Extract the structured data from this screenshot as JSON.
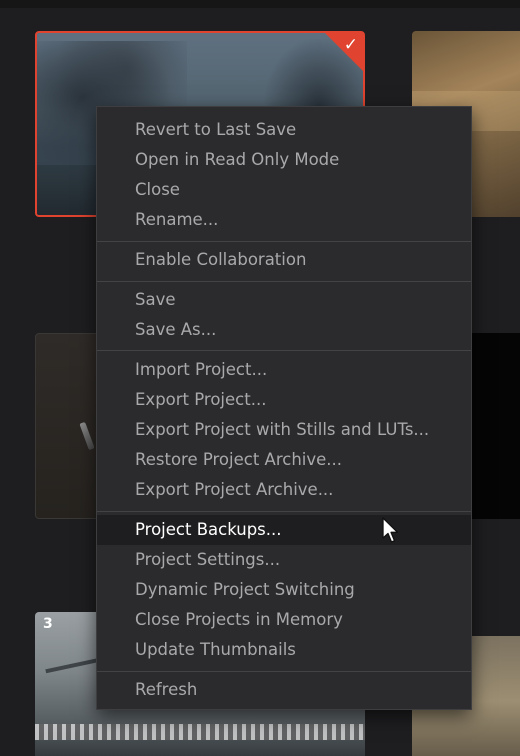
{
  "thumbnails": {
    "selected_check": "✓",
    "bottom_left_number": "3"
  },
  "menu": {
    "items": [
      {
        "label": "Revert to Last Save"
      },
      {
        "label": "Open in Read Only Mode"
      },
      {
        "label": "Close"
      },
      {
        "label": "Rename..."
      },
      {
        "label": "Enable Collaboration"
      },
      {
        "label": "Save"
      },
      {
        "label": "Save As..."
      },
      {
        "label": "Import Project..."
      },
      {
        "label": "Export Project..."
      },
      {
        "label": "Export Project with Stills and LUTs..."
      },
      {
        "label": "Restore Project Archive..."
      },
      {
        "label": "Export Project Archive..."
      },
      {
        "label": "Project Backups..."
      },
      {
        "label": "Project Settings..."
      },
      {
        "label": "Dynamic Project Switching"
      },
      {
        "label": "Close Projects in Memory"
      },
      {
        "label": "Update Thumbnails"
      },
      {
        "label": "Refresh"
      }
    ],
    "highlighted_item": "Project Backups..."
  },
  "colors": {
    "selection_accent": "#e0432f",
    "menu_background": "#2b2b2d",
    "menu_text": "#a9a9ac",
    "menu_text_active": "#ffffff",
    "menu_highlight": "#1e1e20"
  },
  "icons": {
    "selected": "checkmark-icon",
    "pointer": "mouse-pointer-icon"
  }
}
